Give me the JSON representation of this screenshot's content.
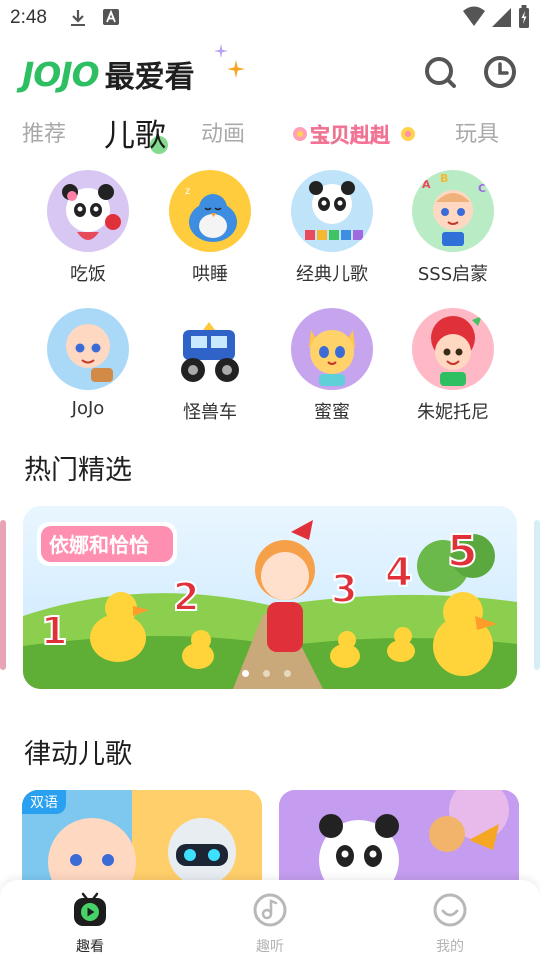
{
  "status_bar": {
    "time": "2:48"
  },
  "header": {
    "logo_word": "JOJO",
    "logo_cn": "最爱看"
  },
  "tabs": [
    {
      "label": "推荐",
      "active": false
    },
    {
      "label": "儿歌",
      "active": true
    },
    {
      "label": "动画",
      "active": false
    },
    {
      "label": "宝贝赳赳",
      "active": false
    },
    {
      "label": "玩具",
      "active": false
    }
  ],
  "categories": [
    {
      "label": "吃饭"
    },
    {
      "label": "哄睡"
    },
    {
      "label": "经典儿歌"
    },
    {
      "label": "SSS启蒙"
    },
    {
      "label": "JoJo"
    },
    {
      "label": "怪兽车"
    },
    {
      "label": "蜜蜜"
    },
    {
      "label": "朱妮托尼"
    }
  ],
  "sections": {
    "hot": "热门精选",
    "rhythm": "律动儿歌"
  },
  "banner": {
    "title_art": "依娜和恰恰",
    "numbers": [
      "1",
      "2",
      "3",
      "4",
      "5"
    ],
    "page_count": 3,
    "active_page": 1
  },
  "video_cards": [
    {
      "badge": "双语"
    },
    {
      "badge": ""
    }
  ],
  "bottom_nav": [
    {
      "label": "趣看",
      "active": true
    },
    {
      "label": "趣听",
      "active": false
    },
    {
      "label": "我的",
      "active": false
    }
  ],
  "colors": {
    "brand_green": "#2fbf63",
    "accent_orange": "#f5a623",
    "badge_blue": "#2aa0f0"
  }
}
